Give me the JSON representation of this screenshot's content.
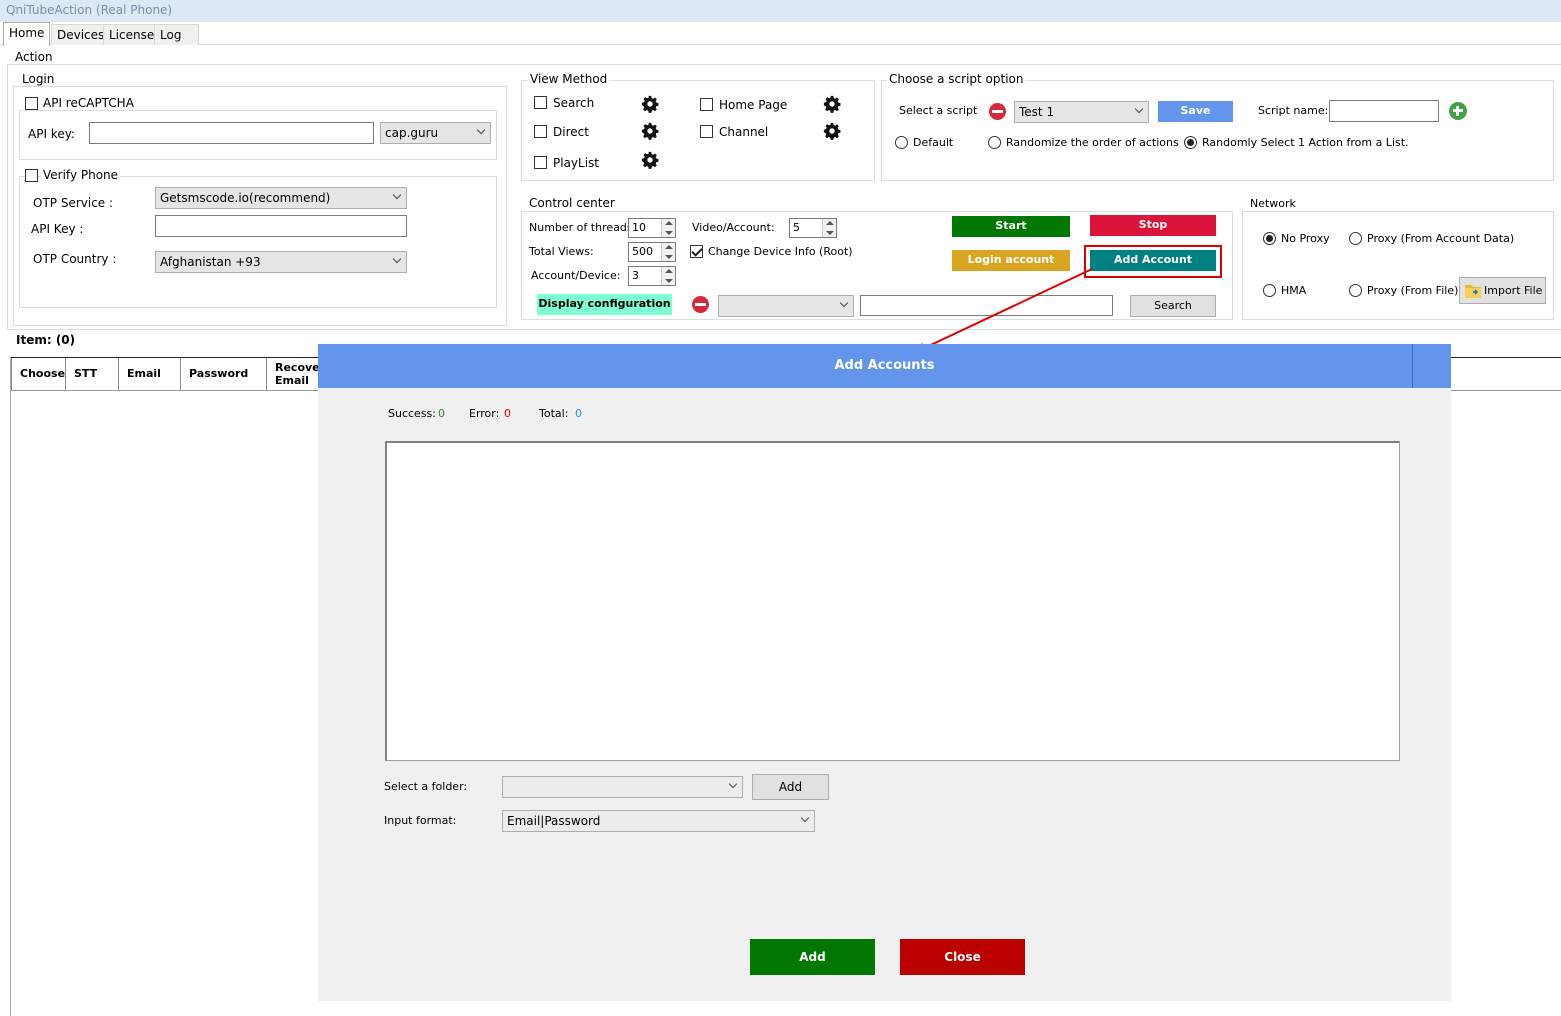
{
  "window": {
    "title": "QniTubeAction (Real Phone)"
  },
  "tabs": [
    "Home",
    "Devices",
    "License",
    "Log"
  ],
  "action_group": "Action",
  "login": {
    "title": "Login",
    "recaptcha_label": "API reCAPTCHA",
    "api_key_label": "API key:",
    "api_key_value": "",
    "captcha_service": "cap.guru",
    "verify_phone_label": "Verify Phone",
    "otp_service_label": "OTP Service :",
    "otp_service_value": "Getsmscode.io(recommend)",
    "otp_api_key_label": "API Key :",
    "otp_api_key_value": "",
    "otp_country_label": "OTP Country :",
    "otp_country_value": "Afghanistan +93"
  },
  "view_method": {
    "title": "View Method",
    "search": "Search",
    "direct": "Direct",
    "playlist": "PlayList",
    "home_page": "Home Page",
    "channel": "Channel"
  },
  "script_option": {
    "title": "Choose a script option",
    "select_label": "Select a script",
    "selected_script": "Test 1",
    "save": "Save",
    "name_label": "Script name:",
    "name_value": "",
    "default": "Default",
    "randomize": "Randomize the order of actions",
    "random_one": "Randomly Select 1 Action from a List."
  },
  "control_center": {
    "title": "Control center",
    "threads_label": "Number of threads:",
    "threads": "10",
    "views_label": "Total Views:",
    "views": "500",
    "acc_dev_label": "Account/Device:",
    "acc_dev": "3",
    "video_acc_label": "Video/Account:",
    "video_acc": "5",
    "change_device": "Change Device Info (Root)",
    "start": "Start",
    "stop": "Stop",
    "login_account": "Login account",
    "add_account": "Add Account",
    "display_config": "Display configuration",
    "search": "Search"
  },
  "network": {
    "title": "Network",
    "no_proxy": "No Proxy",
    "proxy_account": "Proxy (From Account Data)",
    "hma": "HMA",
    "proxy_file": "Proxy (From File)",
    "import_file": "Import File"
  },
  "items_label": "Item: (0)",
  "table_headers": [
    "Choose",
    "STT",
    "Email",
    "Password",
    "Recove\nEmail"
  ],
  "dialog": {
    "title": "Add Accounts",
    "success_label": "Success:",
    "success": "0",
    "error_label": "Error:",
    "error": "0",
    "total_label": "Total:",
    "total": "0",
    "folder_label": "Select a folder:",
    "folder_value": "",
    "add_folder": "Add",
    "format_label": "Input format:",
    "format_value": "Email|Password",
    "add": "Add",
    "close": "Close"
  },
  "colors": {
    "start": "#007700",
    "stop": "#dc143c",
    "login_account": "#daa520",
    "add_account": "#008080",
    "save": "#6495ed",
    "display_config": "#7fffd4",
    "dialog_header": "#6495ed",
    "highlight": "#e00000"
  }
}
